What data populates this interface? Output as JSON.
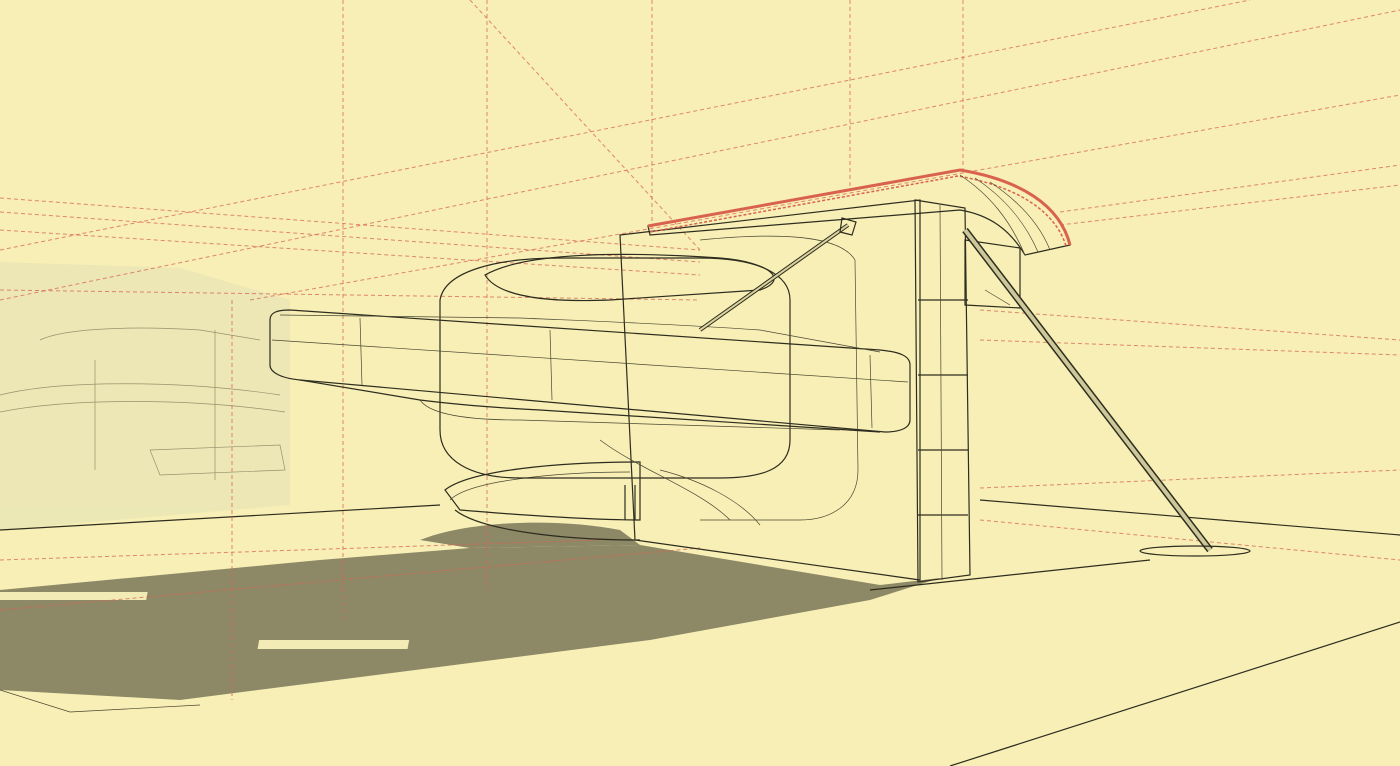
{
  "scene": {
    "background_color": "#f7efb6",
    "shadow_color": "#8d8866",
    "wall_color": "#9c9877",
    "slab_color": "#ece6b3",
    "guide_color": "#d9624f",
    "edge_color": "#2e2c1e"
  }
}
